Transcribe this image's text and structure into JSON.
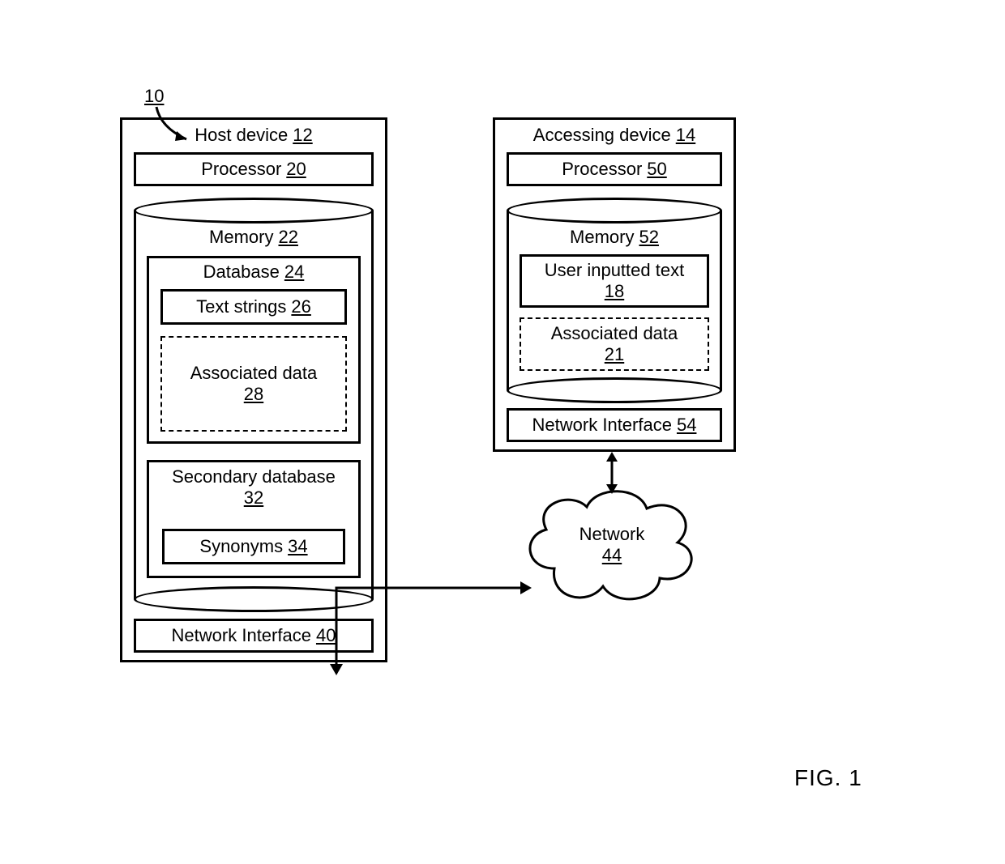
{
  "figure_caption": "FIG. 1",
  "system_ref": "10",
  "network": {
    "label": "Network",
    "ref": "44"
  },
  "host": {
    "title": "Host device",
    "ref": "12",
    "processor": {
      "label": "Processor",
      "ref": "20"
    },
    "memory": {
      "label": "Memory",
      "ref": "22"
    },
    "database": {
      "label": "Database",
      "ref": "24"
    },
    "text_strings": {
      "label": "Text strings",
      "ref": "26"
    },
    "assoc_data": {
      "label": "Associated data",
      "ref": "28"
    },
    "secondary_db": {
      "label": "Secondary database",
      "ref": "32"
    },
    "synonyms": {
      "label": "Synonyms",
      "ref": "34"
    },
    "net_if": {
      "label": "Network Interface",
      "ref": "40"
    }
  },
  "client": {
    "title": "Accessing device",
    "ref": "14",
    "processor": {
      "label": "Processor",
      "ref": "50"
    },
    "memory": {
      "label": "Memory",
      "ref": "52"
    },
    "user_text": {
      "label": "User inputted text",
      "ref": "18"
    },
    "assoc_data": {
      "label": "Associated data",
      "ref": "21"
    },
    "net_if": {
      "label": "Network Interface",
      "ref": "54"
    }
  }
}
